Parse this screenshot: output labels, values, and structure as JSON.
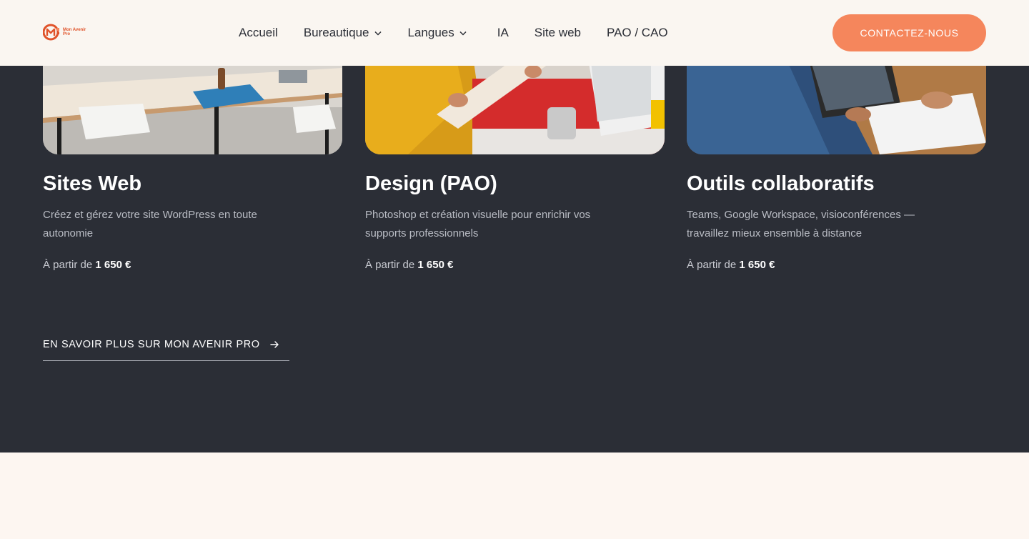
{
  "brand": {
    "logo_text": "Mon Avenir Pro",
    "accent_color": "#e0532a",
    "button_color": "#f5865c"
  },
  "nav": {
    "items": [
      {
        "label": "Accueil",
        "has_dropdown": false
      },
      {
        "label": "Bureautique",
        "has_dropdown": true
      },
      {
        "label": "Langues",
        "has_dropdown": true
      },
      {
        "label": "IA",
        "has_dropdown": false
      },
      {
        "label": "Site web",
        "has_dropdown": false
      },
      {
        "label": "PAO / CAO",
        "has_dropdown": false
      }
    ],
    "contact_label": "CONTACTEZ-NOUS"
  },
  "cards": [
    {
      "title": "Sites Web",
      "description": "Créez et gérez votre site WordPress en toute autonomie",
      "price_prefix": "À partir de",
      "price": "1 650 €",
      "image": "office-desks-photo"
    },
    {
      "title": "Design (PAO)",
      "description": "Photoshop et création visuelle pour enrichir vos supports professionnels",
      "price_prefix": "À partir de",
      "price": "1 650 €",
      "image": "designer-paper-photo"
    },
    {
      "title": "Outils collaboratifs",
      "description": "Teams, Google Workspace, visioconférences — travaillez mieux ensemble à distance",
      "price_prefix": "À partir de",
      "price": "1 650 €",
      "image": "team-meeting-photo"
    }
  ],
  "learn_more": {
    "label": "EN SAVOIR PLUS SUR MON AVENIR PRO",
    "icon": "arrow-right-icon"
  },
  "colors": {
    "dark_section": "#2b2e36",
    "header_bg": "#faf6f1",
    "bottom_section": "#fdf6f1"
  }
}
